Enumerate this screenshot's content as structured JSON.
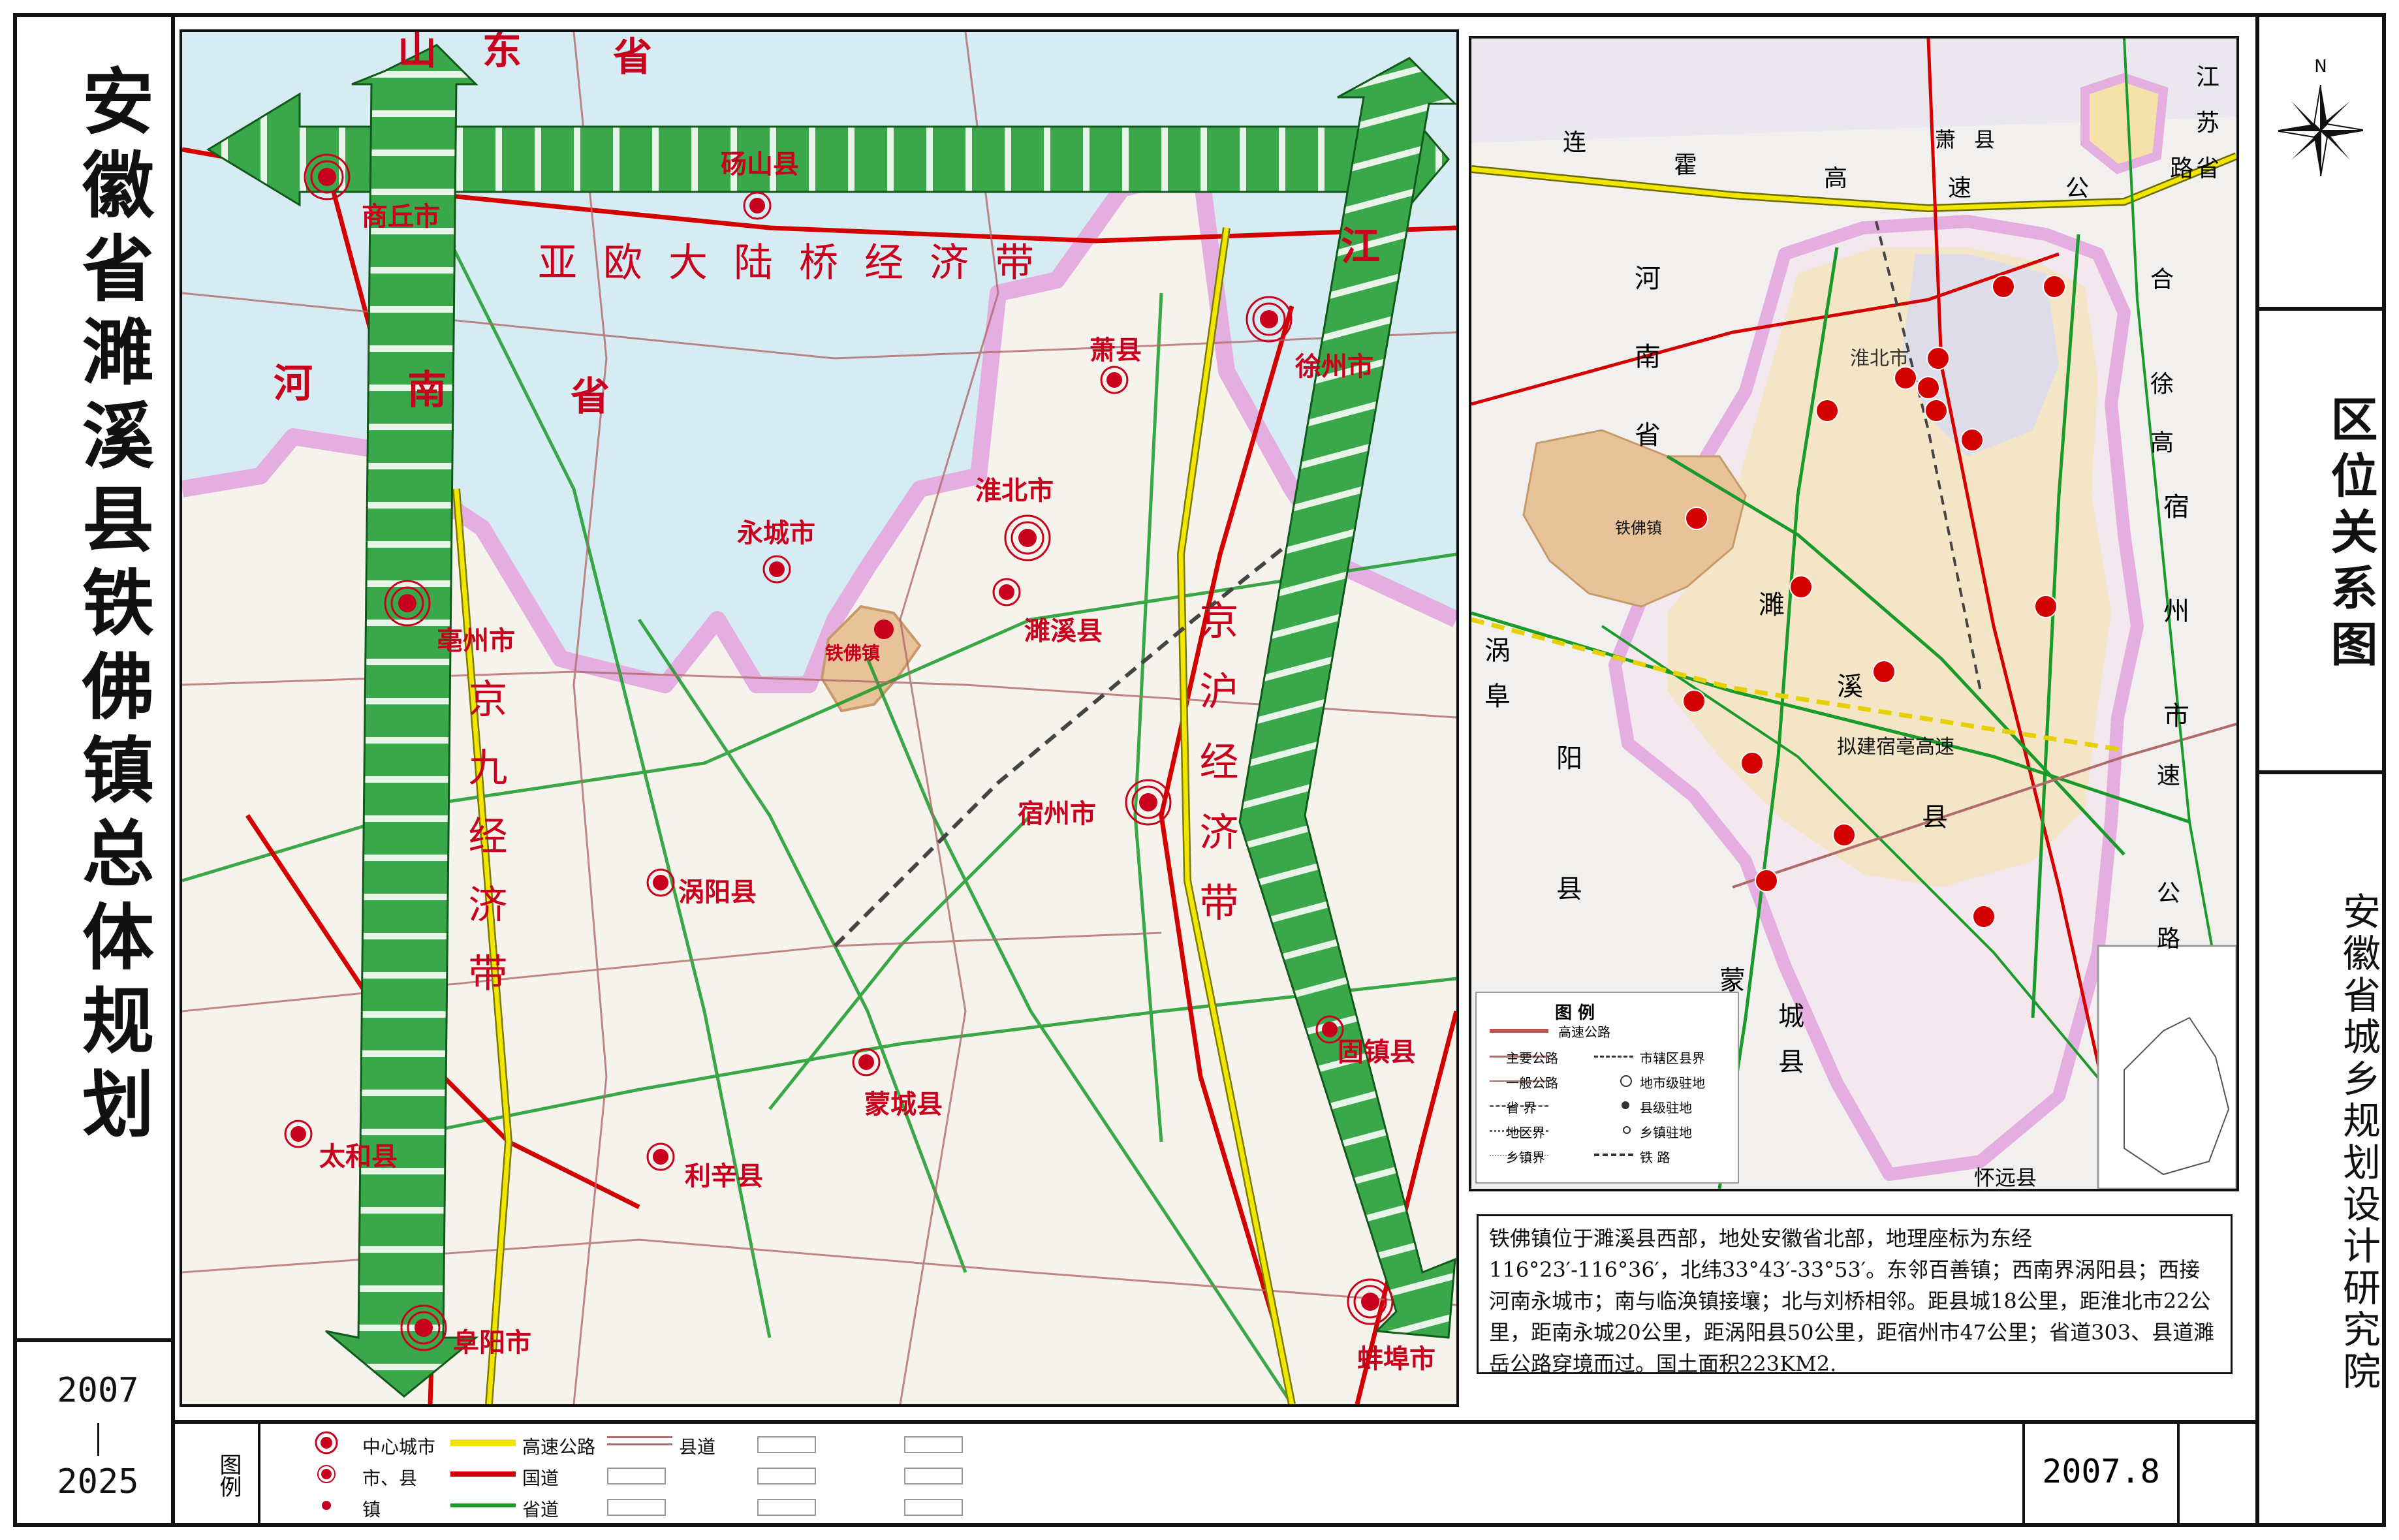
{
  "title": "安徽省濉溪县铁佛镇总体规划",
  "years": {
    "start": "2007",
    "end": "2025"
  },
  "sheet_title": "区位关系图",
  "institute": "安徽省城乡规划设计研究院",
  "date": "2007.8",
  "north_label": "N",
  "legend": {
    "label": "图例",
    "items": [
      {
        "label": "中心城市",
        "type": "center-city"
      },
      {
        "label": "市、县",
        "type": "city-county"
      },
      {
        "label": "镇",
        "type": "town"
      },
      {
        "label": "高速公路",
        "type": "expressway",
        "color": "#f2e600"
      },
      {
        "label": "国道",
        "type": "national-road",
        "color": "#d40000"
      },
      {
        "label": "省道",
        "type": "provincial-road",
        "color": "#1a9a2a"
      },
      {
        "label": "县道",
        "type": "county-road",
        "color": "#b06a6a"
      }
    ]
  },
  "main_map": {
    "provinces": [
      "山",
      "东",
      "省",
      "河",
      "南",
      "省",
      "江"
    ],
    "corridors": [
      "亚欧大陆桥经济带",
      "京沪经济带",
      "京九经济带"
    ],
    "center_cities": [
      "商丘市",
      "徐州市",
      "淮北市",
      "亳州市",
      "宿州市",
      "阜阳市",
      "蚌埠市"
    ],
    "counties": [
      "砀山县",
      "萧县",
      "永城市",
      "濉溪县",
      "涡阳县",
      "蒙城县",
      "利辛县",
      "太和县",
      "固镇县"
    ],
    "towns": [
      "铁佛镇"
    ]
  },
  "inset_map": {
    "labels": [
      "连",
      "霍",
      "高",
      "速",
      "公",
      "路",
      "萧",
      "县",
      "江",
      "苏",
      "省",
      "河",
      "南",
      "省",
      "淮北市",
      "濉",
      "溪",
      "县",
      "宿",
      "州",
      "市",
      "涡",
      "阜",
      "阳",
      "县",
      "蒙",
      "城",
      "县",
      "怀远县",
      "铁佛镇",
      "拟建宿亳高速",
      "合",
      "徐",
      "高",
      "速",
      "公",
      "路"
    ],
    "legend": {
      "title": "图 例",
      "rows": [
        [
          "高速公路"
        ],
        [
          "主要公路",
          "市辖区县界"
        ],
        [
          "一般公路",
          "地市级驻地"
        ],
        [
          "省 界",
          "县级驻地"
        ],
        [
          "地区界",
          "乡镇驻地"
        ],
        [
          "乡镇界",
          "铁 路"
        ]
      ]
    }
  },
  "description": "铁佛镇位于濉溪县西部，地处安徽省北部，地理座标为东经116°23′-116°36′，北纬33°43′-33°53′。东邻百善镇；西南界涡阳县；西接河南永城市；南与临涣镇接壤；北与刘桥相邻。距县城18公里，距淮北市22公里，距南永城20公里，距涡阳县50公里，距宿州市47公里；省道303、县道濉岳公路穿境而过。国土面积223KM2."
}
